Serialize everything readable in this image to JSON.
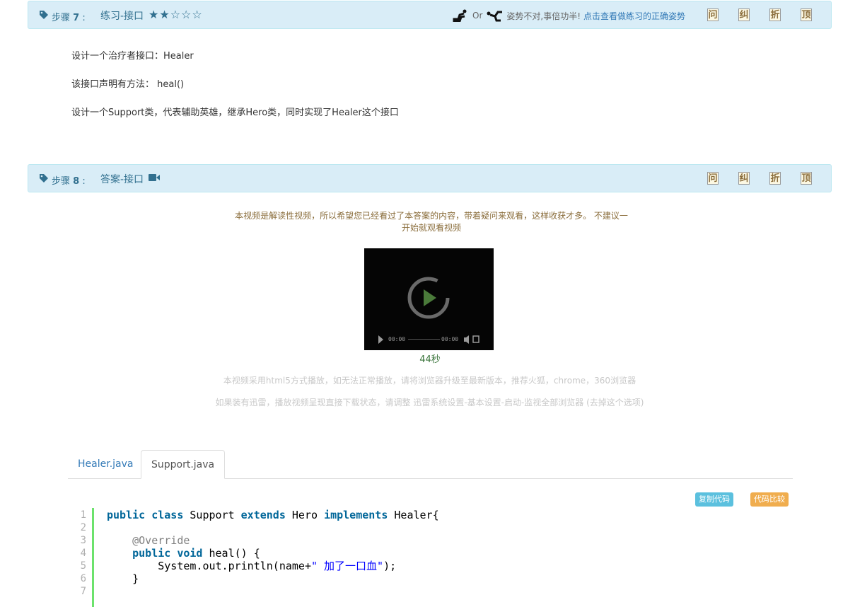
{
  "step7": {
    "label_prefix": "步骤",
    "number": "7",
    "colon": " :",
    "title": "练习-接口",
    "stars": "★★☆☆☆",
    "or_text": "Or",
    "hint": "姿势不对,事倍功半!",
    "hint_link": "点击查看做练习的正确姿势",
    "controls": [
      "问",
      "纠",
      "折",
      "顶"
    ]
  },
  "task": {
    "line1": "设计一个治疗者接口：Healer",
    "line2": "该接口声明有方法： heal()",
    "line3": "设计一个Support类，代表辅助英雄，继承Hero类，同时实现了Healer这个接口"
  },
  "step8": {
    "label_prefix": "步骤",
    "number": "8",
    "colon": " :",
    "title": "答案-接口",
    "controls": [
      "问",
      "纠",
      "折",
      "顶"
    ]
  },
  "video": {
    "notice": "本视频是解读性视频，所以希望您已经看过了本答案的内容，带着疑问来观看，这样收获才多。 不建议一开始就观看视频",
    "time_current": "00:00",
    "time_total": "00:00",
    "duration": "44秒",
    "tip1": "本视频采用html5方式播放，如无法正常播放，请将浏览器升级至最新版本，推荐火狐，chrome，360浏览器",
    "tip2": "如果装有迅雷，播放视频呈现直接下载状态，请调整 迅雷系统设置-基本设置-启动-监视全部浏览器 (去掉这个选项)"
  },
  "tabs": [
    {
      "label": "Healer.java",
      "active": false
    },
    {
      "label": "Support.java",
      "active": true
    }
  ],
  "buttons": {
    "copy": "复制代码",
    "compare": "代码比较"
  },
  "code": {
    "line_numbers": [
      "1",
      "2",
      "3",
      "4",
      "5",
      "6",
      "7"
    ],
    "l1": {
      "kw1": "public",
      "kw2": "class",
      "t1": "Support",
      "kw3": "extends",
      "t2": "Hero",
      "kw4": "implements",
      "t3": "Healer{"
    },
    "l3": {
      "ann": "@Override"
    },
    "l4": {
      "kw1": "public",
      "kw2": "void",
      "t1": "heal() {"
    },
    "l5": {
      "t1": "System.out.println(name+",
      "str": "\" 加了一口血\"",
      "t2": ");"
    },
    "l6": {
      "t1": "}"
    }
  },
  "colors": {
    "header_bg": "#d9edf7",
    "header_text": "#31708f",
    "link": "#337ab7",
    "gutter_bar": "#6ce26c",
    "keyword": "#006699",
    "copy_btn": "#5bc0de",
    "compare_btn": "#f0ad4e"
  }
}
